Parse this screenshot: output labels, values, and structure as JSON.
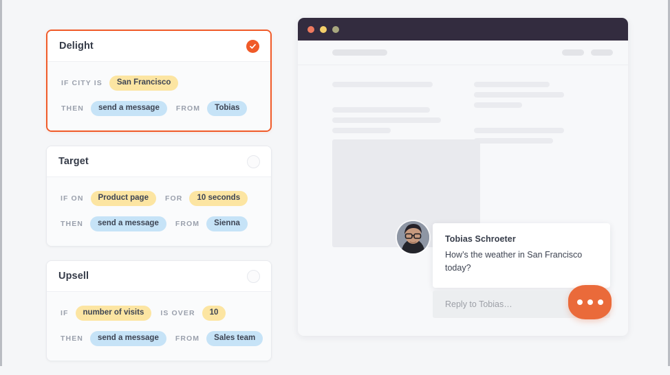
{
  "rules": {
    "cards": [
      {
        "title": "Delight",
        "state": "checked",
        "toggle_icon": "check-circle-icon",
        "rows": [
          {
            "parts": [
              {
                "kind": "keyword",
                "text": "IF CITY IS"
              },
              {
                "kind": "pill",
                "text": "San Francisco",
                "color": "yellow"
              }
            ]
          },
          {
            "parts": [
              {
                "kind": "keyword",
                "text": "THEN"
              },
              {
                "kind": "pill",
                "text": "send a message",
                "color": "blue"
              },
              {
                "kind": "keyword",
                "text": "FROM",
                "spaced": true
              },
              {
                "kind": "pill",
                "text": "Tobias",
                "color": "blue"
              }
            ]
          }
        ]
      },
      {
        "title": "Target",
        "state": "unchecked",
        "toggle_icon": "empty-circle-icon",
        "rows": [
          {
            "parts": [
              {
                "kind": "keyword",
                "text": "IF ON"
              },
              {
                "kind": "pill",
                "text": "Product page",
                "color": "yellow"
              },
              {
                "kind": "keyword",
                "text": "FOR",
                "spaced": true
              },
              {
                "kind": "pill",
                "text": "10 seconds",
                "color": "yellow"
              }
            ]
          },
          {
            "parts": [
              {
                "kind": "keyword",
                "text": "THEN"
              },
              {
                "kind": "pill",
                "text": "send a message",
                "color": "blue"
              },
              {
                "kind": "keyword",
                "text": "FROM",
                "spaced": true
              },
              {
                "kind": "pill",
                "text": "Sienna",
                "color": "blue"
              }
            ]
          }
        ]
      },
      {
        "title": "Upsell",
        "state": "unchecked",
        "toggle_icon": "empty-circle-icon",
        "rows": [
          {
            "parts": [
              {
                "kind": "keyword",
                "text": "IF"
              },
              {
                "kind": "pill",
                "text": "number of visits",
                "color": "yellow"
              },
              {
                "kind": "keyword",
                "text": "IS OVER",
                "spaced": true
              },
              {
                "kind": "pill",
                "text": "10",
                "color": "yellow"
              }
            ]
          },
          {
            "parts": [
              {
                "kind": "keyword",
                "text": "THEN"
              },
              {
                "kind": "pill",
                "text": "send a message",
                "color": "blue"
              },
              {
                "kind": "keyword",
                "text": "FROM",
                "spaced": true
              },
              {
                "kind": "pill",
                "text": "Sales team",
                "color": "blue"
              }
            ]
          }
        ]
      }
    ]
  },
  "browser": {
    "titlebar": {
      "dots": [
        {
          "name": "close-dot",
          "color": "#ee7a5f"
        },
        {
          "name": "minimize-dot",
          "color": "#f3cf6a"
        },
        {
          "name": "maximize-dot",
          "color": "#a8a77f"
        }
      ]
    },
    "toolbar": {
      "url_placeholder_widths": [
        80
      ],
      "button_placeholder_count": 2
    },
    "body": {
      "skeleton_left_lines": [
        146,
        0,
        142,
        155,
        85
      ],
      "skeleton_right_lines": [
        110,
        131,
        70,
        0,
        131,
        115
      ]
    }
  },
  "chat": {
    "avatar_icon": "user-avatar-photo",
    "sender": "Tobias Schroeter",
    "message": "How’s the weather in San Francisco today?",
    "reply_placeholder": "Reply to Tobias…",
    "emoji_icon": "smiley-icon",
    "attach_icon": "paperclip-icon"
  },
  "launcher": {
    "icon": "ellipsis-icon",
    "dot_count": 3,
    "color": "#ea6a3a"
  },
  "colors": {
    "accent_orange": "#f05a28",
    "launcher_orange": "#ea6a3a",
    "pill_yellow": "#fce5a2",
    "pill_blue": "#c6e3f7",
    "titlebar_dark": "#332c3f",
    "page_bg": "#f5f6f8"
  }
}
